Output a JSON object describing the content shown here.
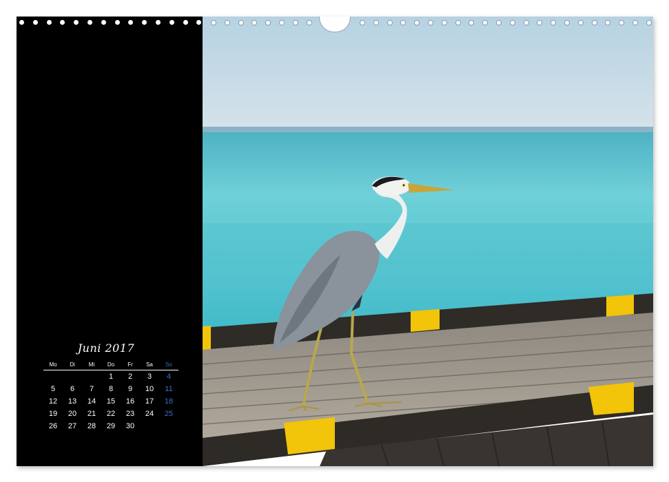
{
  "calendar": {
    "month_title": "Juni 2017",
    "weekdays": [
      "Mo",
      "Di",
      "Mi",
      "Do",
      "Fr",
      "Sa",
      "So"
    ],
    "first_weekday_index": 3,
    "days_in_month": 30,
    "sunday_color": "#3b6fc4"
  },
  "colors": {
    "panel": "#000000",
    "sky": "#c7dbe6",
    "sea": "#5bc7cf",
    "dock_wood": "#a29a8e",
    "dock_edge": "#2e2a26",
    "dock_stripe": "#f2c40a"
  }
}
